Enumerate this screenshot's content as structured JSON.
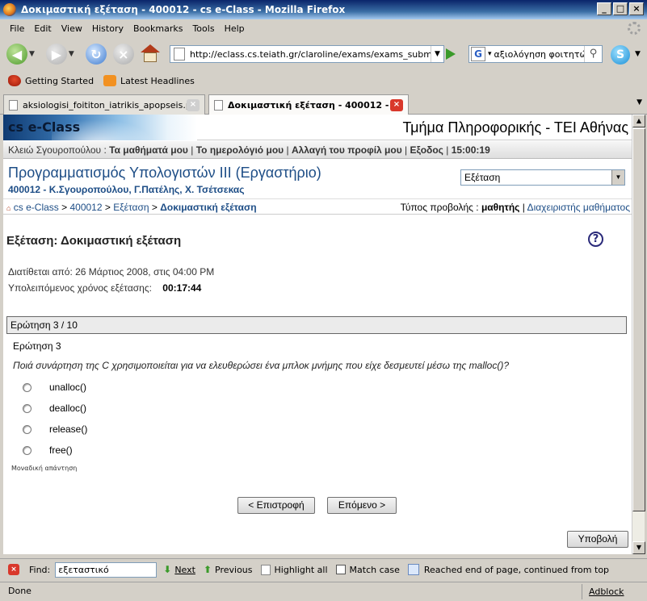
{
  "window": {
    "title": "Δοκιμαστική εξέταση - 400012 - cs e-Class - Mozilla Firefox"
  },
  "menu": [
    "File",
    "Edit",
    "View",
    "History",
    "Bookmarks",
    "Tools",
    "Help"
  ],
  "nav": {
    "url": "http://eclass.cs.teiath.gr/claroline/exams/exams_submit.php",
    "search_text": "αξιολόγηση φοιτητών"
  },
  "bookmarks": {
    "getting_started": "Getting Started",
    "latest_headlines": "Latest Headlines"
  },
  "tabs": [
    {
      "label": "aksiologisi_foititon_iatrikis_apopseis.p..."
    },
    {
      "label": "Δοκιμαστική εξέταση - 400012 - ..."
    }
  ],
  "site": {
    "logo": "cs e-Class",
    "department": "Τμήμα Πληροφορικής - ΤΕΙ Αθήνας",
    "user_name": "Κλειώ Σγουροπούλου :",
    "links": [
      "Τα μαθήματά μου",
      "Το ημερολόγιό μου",
      "Αλλαγή του προφίλ μου",
      "Εξοδος",
      "15:00:19"
    ]
  },
  "course": {
    "title": "Προγραμματισμός Υπολογιστών ΙΙΙ (Εργαστήριο)",
    "code_and_staff": "400012 - Κ.Σγουροπούλου, Γ.Πατέλης, Χ. Τσέτσεκας",
    "tool_select": "Εξέταση"
  },
  "breadcrumb": {
    "items": [
      "cs e-Class",
      "400012",
      "Εξέταση"
    ],
    "current": "Δοκιμαστική εξέταση",
    "view_label": "Τύπος προβολής :",
    "view_student": "μαθητής",
    "view_admin": "Διαχειριστής μαθήματος"
  },
  "exam": {
    "heading": "Εξέταση: Δοκιμαστική εξέταση",
    "available": "Διατίθεται από: 26 Μάρτιος 2008, στις 04:00 PM",
    "remaining_label": "Υπολειπόμενος χρόνος εξέτασης:",
    "remaining_time": "00:17:44",
    "question_counter": "Ερώτηση 3 / 10",
    "question_title": "Ερώτηση 3",
    "question_text": "Ποιά συνάρτηση της C χρησιμοποιείται για να ελευθερώσει ένα μπλοκ μνήμης που είχε δεσμευτεί μέσω της malloc()?",
    "options": [
      "unalloc()",
      "dealloc()",
      "release()",
      "free()"
    ],
    "answer_type": "Μοναδική απάντηση",
    "back_button": "< Επιστροφή",
    "next_button": "Επόμενο >",
    "submit_button": "Υποβολή"
  },
  "findbar": {
    "find_label": "Find:",
    "query": "εξεταστικό",
    "next": "Next",
    "previous": "Previous",
    "highlight": "Highlight all",
    "match_case": "Match case",
    "message": "Reached end of page, continued from top"
  },
  "status": {
    "text": "Done",
    "adblock": "Adblock"
  }
}
